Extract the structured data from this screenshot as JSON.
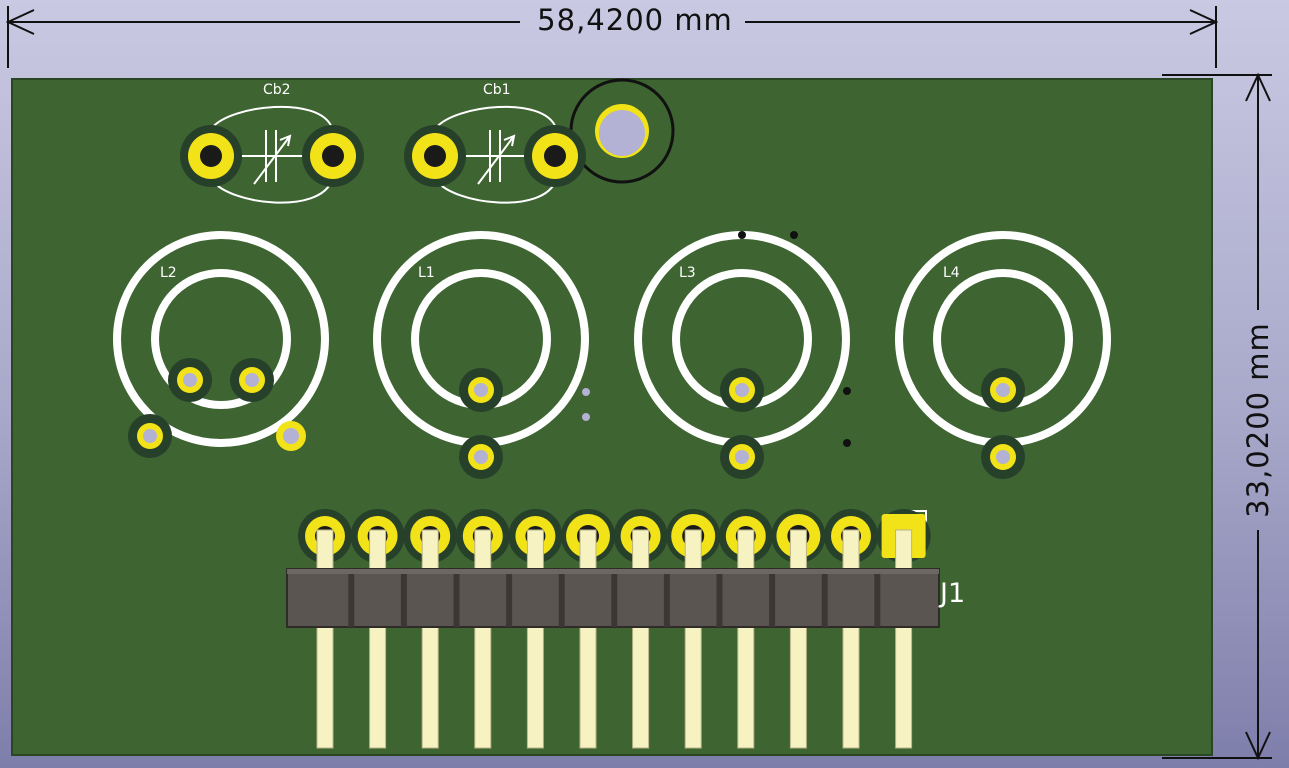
{
  "dimensions": {
    "width_label": "58,4200  mm",
    "height_label": "33,0200  mm"
  },
  "components": {
    "capacitors": [
      {
        "ref": "Cb2"
      },
      {
        "ref": "Cb1"
      }
    ],
    "inductors": [
      {
        "ref": "L2"
      },
      {
        "ref": "L1"
      },
      {
        "ref": "L3"
      },
      {
        "ref": "L4"
      }
    ],
    "connector": {
      "ref": "J1",
      "pin_count": 12
    }
  },
  "colors": {
    "background_top": "#c9c9e3",
    "background_bottom": "#7e7eab",
    "board": "#3e6432",
    "silkscreen": "#ffffff",
    "pad_gold": "#f2e218",
    "header_body": "#5a5551",
    "header_pin": "#f6f2c2"
  }
}
